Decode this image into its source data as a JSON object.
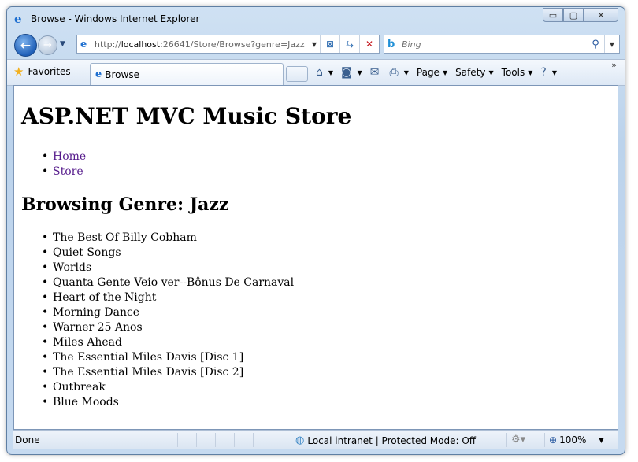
{
  "window": {
    "title": "Browse - Windows Internet Explorer"
  },
  "caption_buttons": {
    "minimize": "▭",
    "maximize": "▢",
    "close": "✕"
  },
  "address": {
    "url_prefix": "http://",
    "url_host": "localhost",
    "url_rest": ":26641/Store/Browse?genre=Jazz"
  },
  "search": {
    "placeholder": "Bing"
  },
  "favorites": {
    "label": "Favorites"
  },
  "tab": {
    "label": "Browse"
  },
  "command_bar": {
    "page": "Page",
    "safety": "Safety",
    "tools": "Tools"
  },
  "page": {
    "site_title": "ASP.NET MVC Music Store",
    "nav": [
      {
        "label": "Home"
      },
      {
        "label": "Store"
      }
    ],
    "heading": "Browsing Genre: Jazz",
    "albums": [
      "The Best Of Billy Cobham",
      "Quiet Songs",
      "Worlds",
      "Quanta Gente Veio ver--Bônus De Carnaval",
      "Heart of the Night",
      "Morning Dance",
      "Warner 25 Anos",
      "Miles Ahead",
      "The Essential Miles Davis [Disc 1]",
      "The Essential Miles Davis [Disc 2]",
      "Outbreak",
      "Blue Moods"
    ]
  },
  "status": {
    "text": "Done",
    "zone": "Local intranet | Protected Mode: Off",
    "zoom": "100%"
  }
}
